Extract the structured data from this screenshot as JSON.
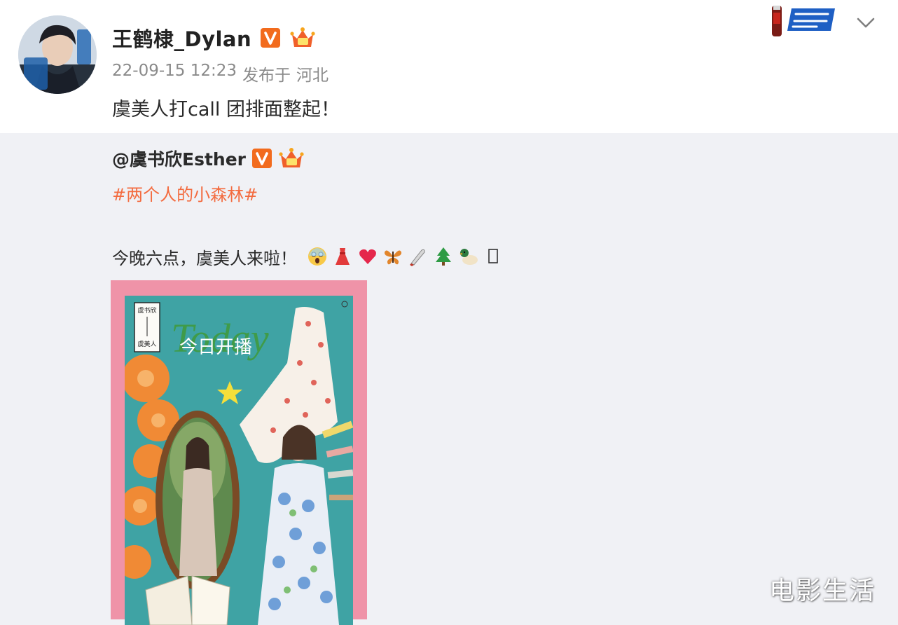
{
  "post": {
    "username": "王鹤棣_Dylan",
    "timestamp": "22-09-15 12:23",
    "published_label": "发布于",
    "location": "河北",
    "text": "虞美人打call 团排面整起！"
  },
  "repost": {
    "author": "@虞书欣Esther",
    "hashtag": "#两个人的小森林#",
    "text": "今晚六点，虞美人来啦！"
  },
  "poster": {
    "brand_lines": [
      "虞书欣",
      "虞美人"
    ],
    "headline": "今日开播",
    "script_text": "Today"
  },
  "watermark": "电影生活",
  "icons": {
    "avatar": "avatar",
    "verified": "verified-v-icon",
    "member": "member-crown-icon",
    "promo": "promo-badge-icon",
    "chevron": "chevron-down-icon",
    "emojis": [
      "scream-face-icon",
      "red-dress-icon",
      "heart-icon",
      "butterfly-icon",
      "knife-icon",
      "tree-icon",
      "duck-icon",
      "missing-glyph-icon"
    ]
  },
  "colors": {
    "verified_orange": "#f26b1d",
    "hashtag": "#f36b3f",
    "frame_pink": "#ef93a8",
    "poster_teal": "#3fa3a4"
  }
}
